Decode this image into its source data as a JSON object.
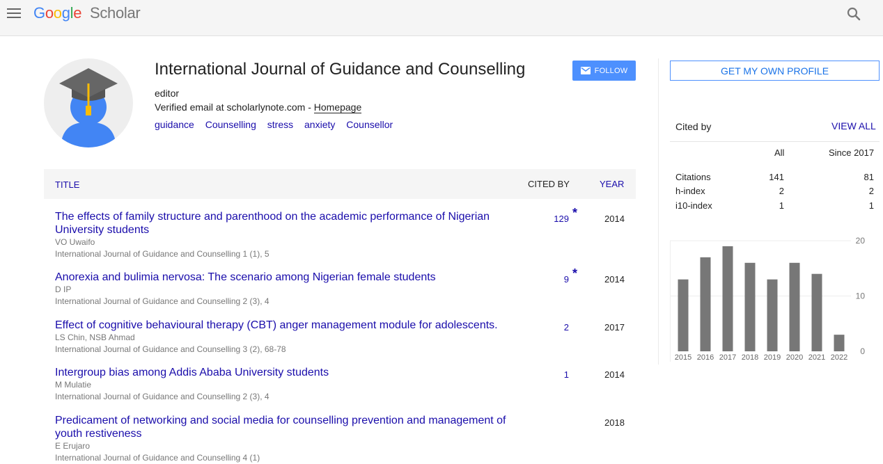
{
  "header": {
    "logo_google": "Google",
    "logo_scholar": "Scholar",
    "icons": {
      "menu": "menu-icon",
      "search": "search-icon"
    }
  },
  "profile": {
    "name": "International Journal of Guidance and Counselling",
    "affiliation": "editor",
    "email_text": "Verified email at scholarlynote.com - ",
    "homepage_label": "Homepage",
    "interests": [
      "guidance",
      "Counselling",
      "stress",
      "anxiety",
      "Counsellor"
    ],
    "follow_label": "FOLLOW"
  },
  "table": {
    "col_title": "TITLE",
    "col_cited_by": "CITED BY",
    "col_year": "YEAR",
    "rows": [
      {
        "title": "The effects of family structure and parenthood on the academic performance of Nigerian University students",
        "authors": "VO Uwaifo",
        "venue": "International Journal of Guidance and Counselling 1 (1), 5",
        "cites": "129",
        "star": "*",
        "year": "2014"
      },
      {
        "title": "Anorexia and bulimia nervosa: The scenario among Nigerian female students",
        "authors": "D IP",
        "venue": "International Journal of Guidance and Counselling 2 (3), 4",
        "cites": "9",
        "star": "*",
        "year": "2014"
      },
      {
        "title": "Effect of cognitive behavioural therapy (CBT) anger management module for adolescents.",
        "authors": "LS Chin, NSB Ahmad",
        "venue": "International Journal of Guidance and Counselling 3 (2), 68-78",
        "cites": "2",
        "star": "",
        "year": "2017"
      },
      {
        "title": "Intergroup bias among Addis Ababa University students",
        "authors": "M Mulatie",
        "venue": "International Journal of Guidance and Counselling 2 (3), 4",
        "cites": "1",
        "star": "",
        "year": "2014"
      },
      {
        "title": "Predicament of networking and social media for counselling prevention and management of youth restiveness",
        "authors": "E Erujaro",
        "venue": "International Journal of Guidance and Counselling 4 (1)",
        "cites": "",
        "star": "",
        "year": "2018"
      }
    ]
  },
  "sidebar": {
    "own_profile_label": "GET MY OWN PROFILE",
    "cited_by_title": "Cited by",
    "view_all_label": "VIEW ALL",
    "col_all": "All",
    "col_since": "Since 2017",
    "stats": [
      {
        "label": "Citations",
        "all": "141",
        "since": "81"
      },
      {
        "label": "h-index",
        "all": "2",
        "since": "2"
      },
      {
        "label": "i10-index",
        "all": "1",
        "since": "1"
      }
    ]
  },
  "chart_data": {
    "type": "bar",
    "categories": [
      "2015",
      "2016",
      "2017",
      "2018",
      "2019",
      "2020",
      "2021",
      "2022"
    ],
    "values": [
      13,
      17,
      19,
      16,
      13,
      16,
      14,
      3
    ],
    "ylim": [
      0,
      20
    ],
    "yticks": [
      0,
      10,
      20
    ],
    "bar_color": "#777777",
    "grid": true
  }
}
